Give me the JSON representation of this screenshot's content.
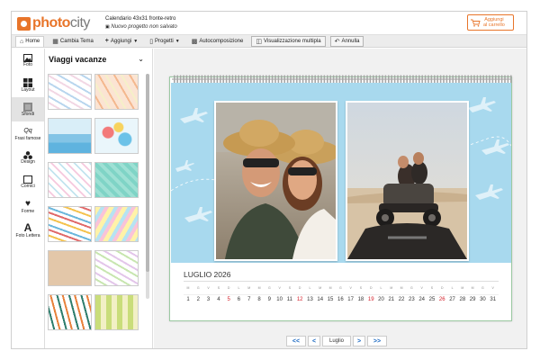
{
  "header": {
    "logo_main": "photo",
    "logo_accent": "city",
    "project_title": "Calendario 43x31 fronte-retro",
    "project_status": "Nuovo progetto non salvato",
    "cart_line1": "Aggiungi",
    "cart_line2": "al carrello"
  },
  "toolbar": {
    "home": "Home",
    "theme": "Cambia Tema",
    "add": "Aggiungi",
    "projects": "Progetti",
    "autocompose": "Autocomposizione",
    "multiview": "Visualizzazione multipla",
    "undo": "Annulla"
  },
  "rail": {
    "items": [
      {
        "label": "Foto",
        "icon": "photo-icon"
      },
      {
        "label": "Layout",
        "icon": "layout-icon"
      },
      {
        "label": "Sfondi",
        "icon": "backgrounds-icon"
      },
      {
        "label": "Frasi famose",
        "icon": "quotes-icon"
      },
      {
        "label": "Design",
        "icon": "design-icon"
      },
      {
        "label": "Cornici",
        "icon": "frames-icon"
      },
      {
        "label": "Forme",
        "icon": "shapes-icon"
      },
      {
        "label": "Foto Lettera",
        "icon": "letter-icon"
      }
    ]
  },
  "panel": {
    "title": "Viaggi vacanze"
  },
  "calendar": {
    "month_title": "LUGLIO 2026",
    "dows": [
      "M",
      "G",
      "V",
      "S",
      "D",
      "L",
      "M",
      "M",
      "G",
      "V",
      "S",
      "D",
      "L",
      "M",
      "M",
      "G",
      "V",
      "S",
      "D",
      "L",
      "M",
      "M",
      "G",
      "V",
      "S",
      "D",
      "L",
      "M",
      "M",
      "G",
      "V"
    ],
    "days": [
      "1",
      "2",
      "3",
      "4",
      "5",
      "6",
      "7",
      "8",
      "9",
      "10",
      "11",
      "12",
      "13",
      "14",
      "15",
      "16",
      "17",
      "18",
      "19",
      "20",
      "21",
      "22",
      "23",
      "24",
      "25",
      "26",
      "27",
      "28",
      "29",
      "30",
      "31"
    ],
    "sundays": [
      5,
      12,
      19,
      26
    ]
  },
  "pager": {
    "first": "<<",
    "prev": "<",
    "current": "Luglio",
    "next": ">",
    "last": ">>"
  },
  "colors": {
    "brand": "#e8752a",
    "sky": "#a8d9ee",
    "sunday": "#d3202a"
  }
}
